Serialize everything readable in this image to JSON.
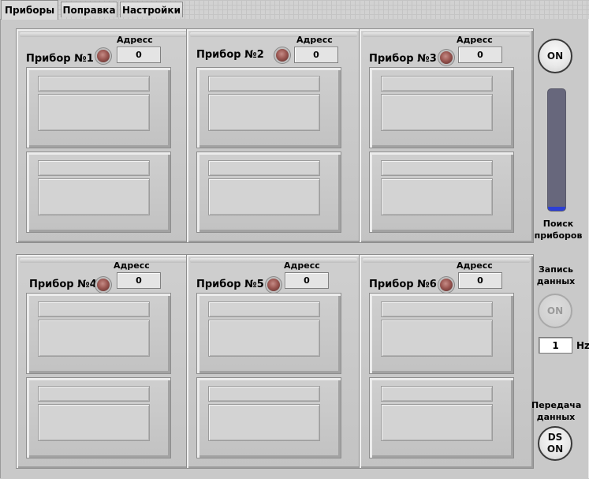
{
  "tabs": [
    {
      "label": "Приборы",
      "active": true
    },
    {
      "label": "Поправка",
      "active": false
    },
    {
      "label": "Настройки",
      "active": false
    }
  ],
  "devices": [
    {
      "name": "Прибор №1",
      "address_label": "Адресс",
      "address": "0"
    },
    {
      "name": "Прибор №2",
      "address_label": "Адресс",
      "address": "0"
    },
    {
      "name": "Прибор №3",
      "address_label": "Адресс",
      "address": "0"
    },
    {
      "name": "Прибор №4",
      "address_label": "Адресс",
      "address": "0"
    },
    {
      "name": "Прибор №5",
      "address_label": "Адресс",
      "address": "0"
    },
    {
      "name": "Прибор №6",
      "address_label": "Адресс",
      "address": "0"
    }
  ],
  "side": {
    "power_button": "ON",
    "search_meter_level": 0.03,
    "search_label_line1": "Поиск",
    "search_label_line2": "приборов",
    "record_label_line1": "Запись",
    "record_label_line2": "данных",
    "record_button": "ON",
    "frequency_value": "1",
    "frequency_unit": "Hz",
    "transfer_label_line1": "Передача",
    "transfer_label_line2": "данных",
    "transfer_button_line1": "DS",
    "transfer_button_line2": "ON"
  },
  "colors": {
    "meter_track": "#67677c",
    "meter_fill": "#2c3fd6",
    "led": "#9b5752"
  }
}
